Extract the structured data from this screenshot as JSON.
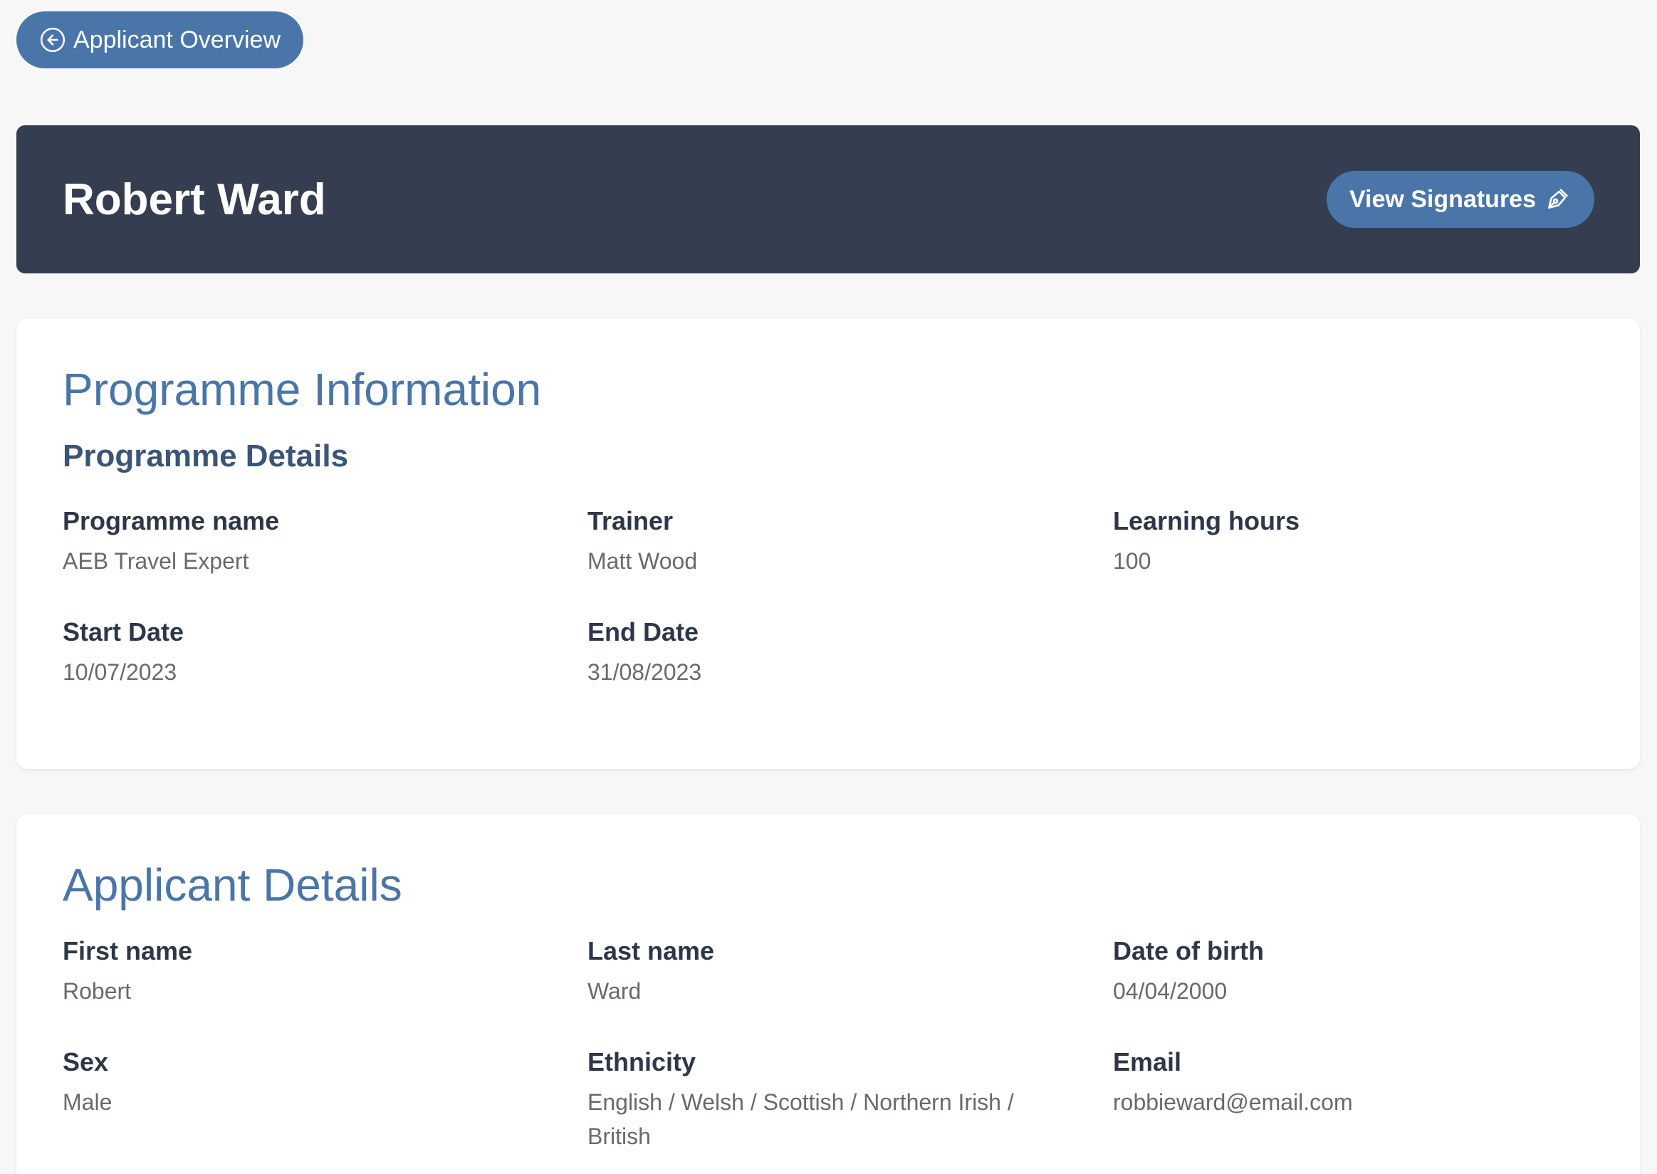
{
  "nav": {
    "back_label": "Applicant Overview"
  },
  "header": {
    "name": "Robert Ward",
    "signatures_label": "View Signatures"
  },
  "programme": {
    "title": "Programme Information",
    "subtitle": "Programme Details",
    "fields": [
      {
        "label": "Programme name",
        "value": "AEB Travel Expert"
      },
      {
        "label": "Trainer",
        "value": "Matt Wood"
      },
      {
        "label": "Learning hours",
        "value": "100"
      },
      {
        "label": "Start Date",
        "value": "10/07/2023"
      },
      {
        "label": "End Date",
        "value": "31/08/2023"
      }
    ]
  },
  "applicant": {
    "title": "Applicant Details",
    "fields": [
      {
        "label": "First name",
        "value": "Robert"
      },
      {
        "label": "Last name",
        "value": "Ward"
      },
      {
        "label": "Date of birth",
        "value": "04/04/2000"
      },
      {
        "label": "Sex",
        "value": "Male"
      },
      {
        "label": "Ethnicity",
        "value": "English / Welsh / Scottish / Northern Irish / British"
      },
      {
        "label": "Email",
        "value": "robbieward@email.com"
      }
    ]
  },
  "icons": {
    "back": "circle-arrow-left-icon",
    "signature": "pen-nib-icon"
  },
  "colors": {
    "accent": "#4a75a8",
    "header_bg": "#343e50",
    "page_bg": "#f7f7f7"
  }
}
